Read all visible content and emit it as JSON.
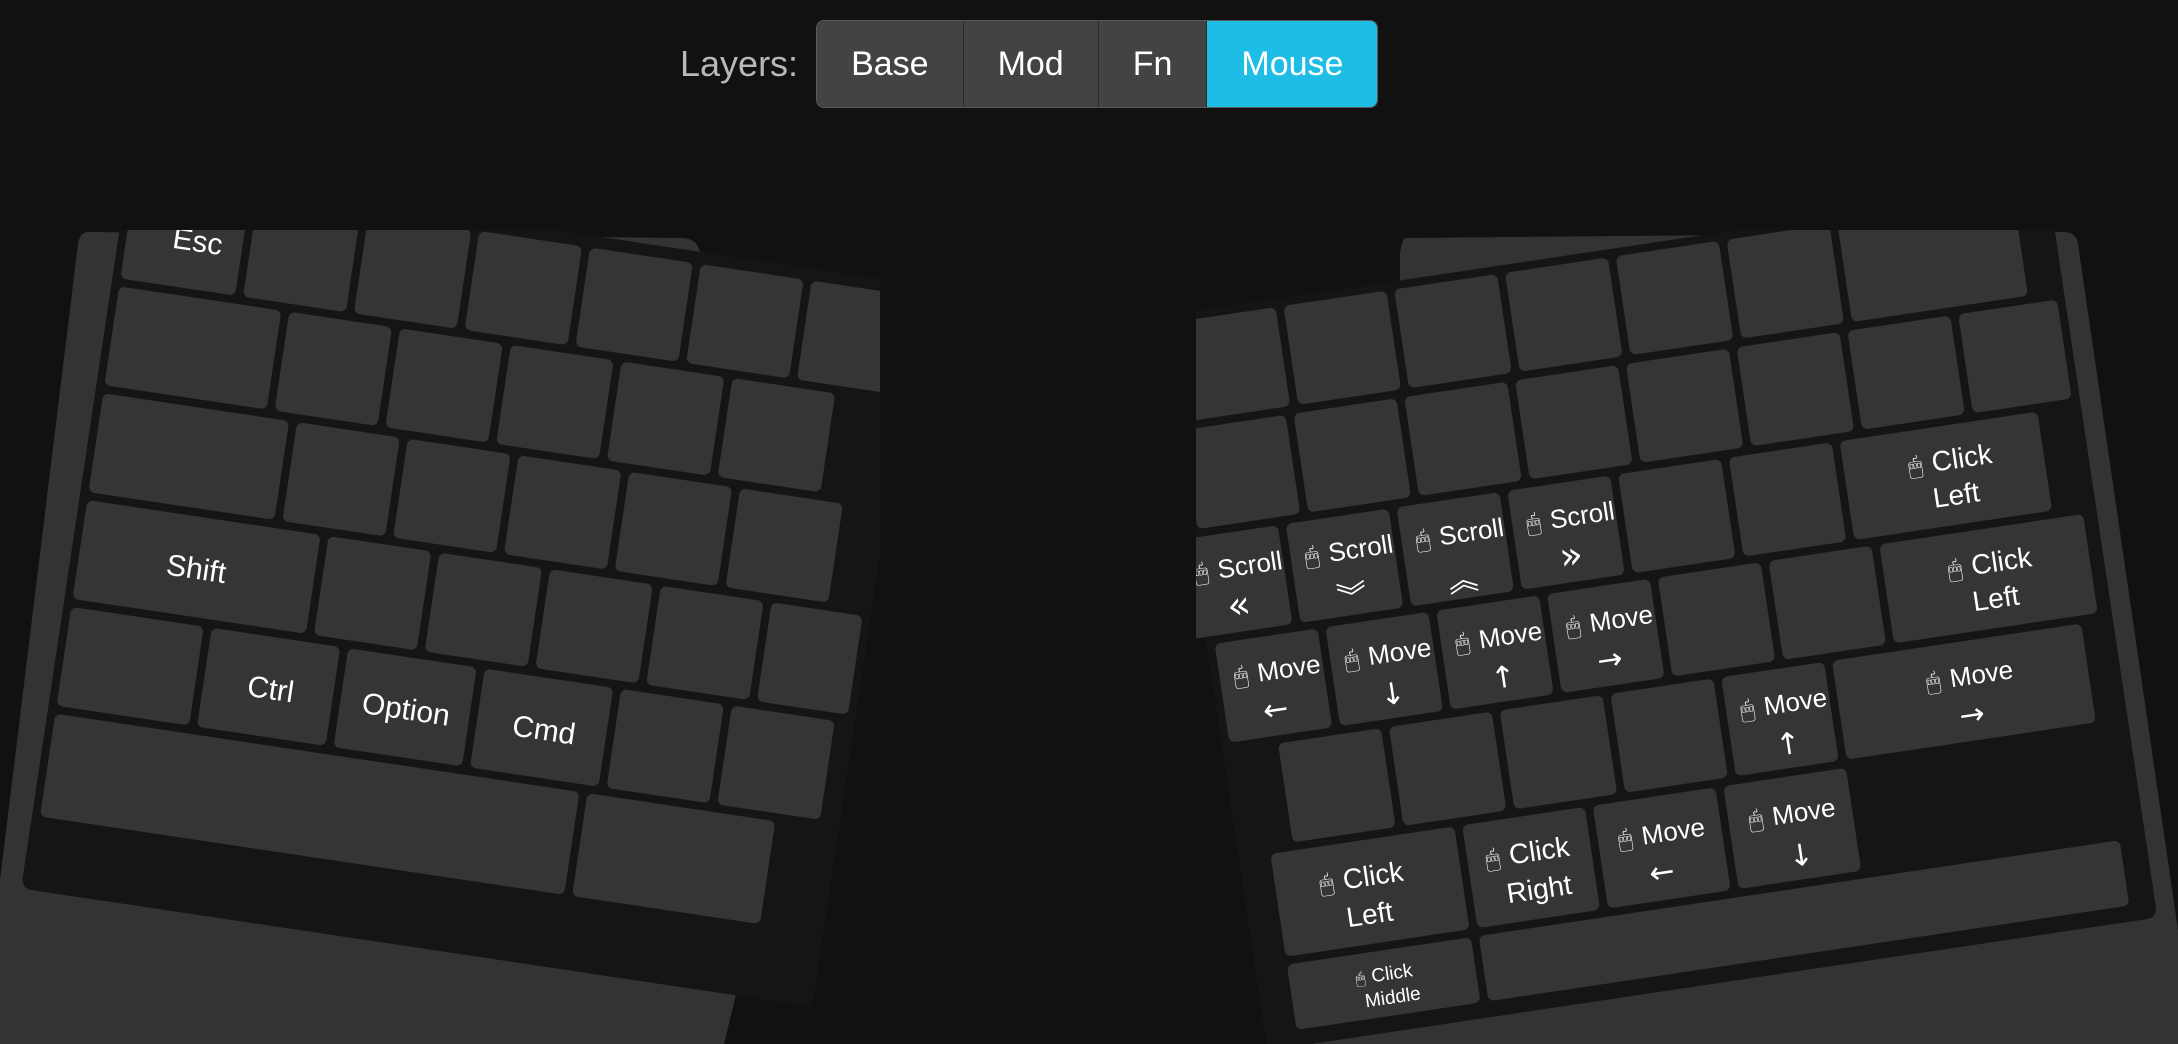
{
  "layers": {
    "label": "Layers:",
    "buttons": [
      {
        "label": "Base",
        "active": false
      },
      {
        "label": "Mod",
        "active": false
      },
      {
        "label": "Fn",
        "active": false
      },
      {
        "label": "Mouse",
        "active": true
      }
    ],
    "active_color": "#1ebde6"
  },
  "left_half": {
    "keys": {
      "esc": "Esc",
      "shift": "Shift",
      "ctrl": "Ctrl",
      "option": "Option",
      "cmd": "Cmd"
    }
  },
  "right_half": {
    "keys": {
      "scroll_left": {
        "label": "Scroll",
        "icon": "mouse-icon",
        "arrow": "«"
      },
      "scroll_down": {
        "label": "Scroll",
        "icon": "mouse-icon",
        "arrow": "︾"
      },
      "scroll_up": {
        "label": "Scroll",
        "icon": "mouse-icon",
        "arrow": "︽"
      },
      "scroll_right": {
        "label": "Scroll",
        "icon": "mouse-icon",
        "arrow": "»"
      },
      "click_left_1": {
        "line1": "Click",
        "line2": "Left",
        "icon": "mouse-icon"
      },
      "move_left_1": {
        "label": "Move",
        "icon": "mouse-icon",
        "arrow": "←"
      },
      "move_down_1": {
        "label": "Move",
        "icon": "mouse-icon",
        "arrow": "↓"
      },
      "move_up_1": {
        "label": "Move",
        "icon": "mouse-icon",
        "arrow": "↑"
      },
      "move_right_1": {
        "label": "Move",
        "icon": "mouse-icon",
        "arrow": "→"
      },
      "click_left_2": {
        "line1": "Click",
        "line2": "Left",
        "icon": "mouse-icon"
      },
      "move_up_2": {
        "label": "Move",
        "icon": "mouse-icon",
        "arrow": "↑"
      },
      "move_right_2": {
        "label": "Move",
        "icon": "mouse-icon",
        "arrow": "→"
      },
      "click_left_3": {
        "line1": "Click",
        "line2": "Left",
        "icon": "mouse-icon"
      },
      "click_right": {
        "line1": "Click",
        "line2": "Right",
        "icon": "mouse-icon"
      },
      "move_left_2": {
        "label": "Move",
        "icon": "mouse-icon",
        "arrow": "←"
      },
      "move_down_2": {
        "label": "Move",
        "icon": "mouse-icon",
        "arrow": "↓"
      },
      "click_middle": {
        "line1": "Click",
        "line2": "Middle",
        "icon": "mouse-icon"
      }
    }
  }
}
